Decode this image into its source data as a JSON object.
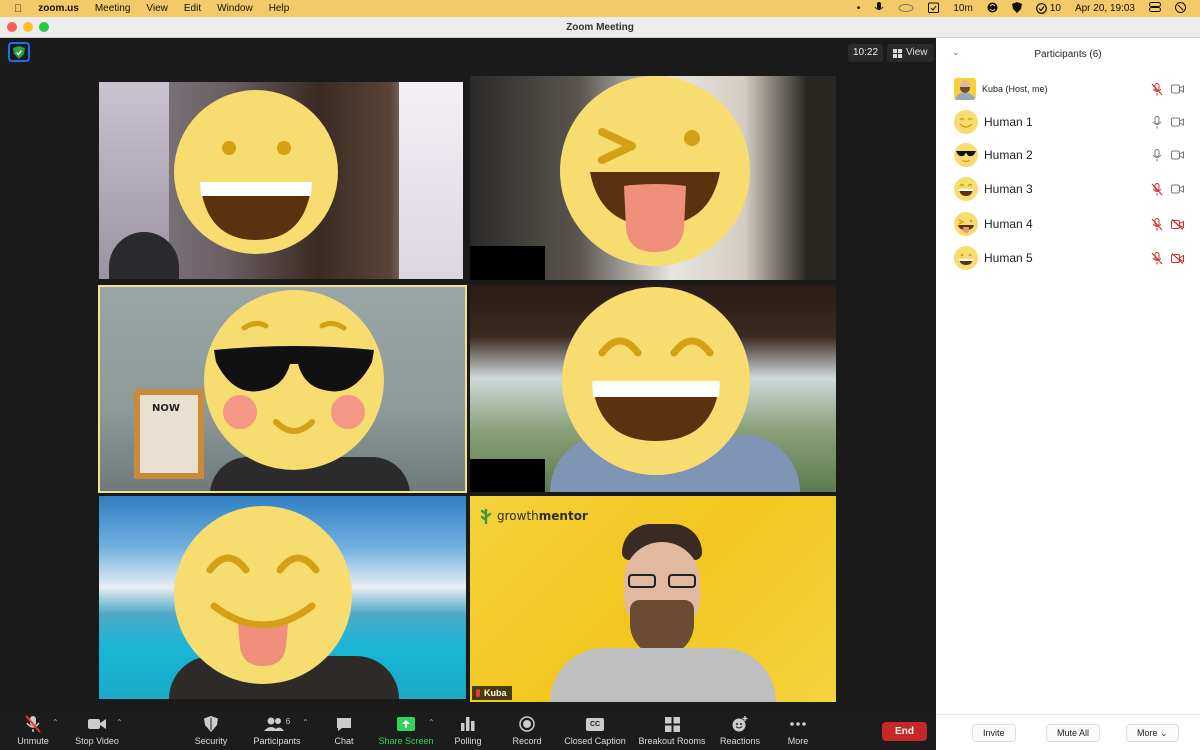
{
  "menubar": {
    "app_name": "zoom.us",
    "items": [
      "Meeting",
      "View",
      "Edit",
      "Window",
      "Help"
    ],
    "status": {
      "timer": "10m",
      "count": "10",
      "datetime": "Apr 20, 19:03"
    }
  },
  "window": {
    "title": "Zoom Meeting"
  },
  "stage": {
    "clock": "10:22",
    "view_label": "View"
  },
  "tiles": [
    {
      "id": "tile-1",
      "emoji": "grin"
    },
    {
      "id": "tile-2",
      "emoji": "wink-tongue"
    },
    {
      "id": "tile-3",
      "emoji": "sunglasses",
      "poster": "NOW"
    },
    {
      "id": "tile-4",
      "emoji": "laugh"
    },
    {
      "id": "tile-5",
      "emoji": "squint-tongue"
    },
    {
      "id": "tile-6",
      "brand": "growthmentor",
      "brand_part1": "growth",
      "brand_part2": "mentor",
      "name": "Kuba"
    }
  ],
  "toolbar": {
    "items": [
      {
        "label": "Unmute",
        "icon": "mic-off-icon"
      },
      {
        "label": "Stop Video",
        "icon": "video-icon"
      },
      {
        "label": "Security",
        "icon": "shield-icon"
      },
      {
        "label": "Participants",
        "icon": "participants-icon",
        "badge": "6"
      },
      {
        "label": "Chat",
        "icon": "chat-icon"
      },
      {
        "label": "Share Screen",
        "icon": "share-screen-icon"
      },
      {
        "label": "Polling",
        "icon": "polling-icon"
      },
      {
        "label": "Record",
        "icon": "record-icon"
      },
      {
        "label": "Closed Caption",
        "icon": "cc-icon",
        "icon_text": "CC"
      },
      {
        "label": "Breakout Rooms",
        "icon": "breakout-icon"
      },
      {
        "label": "Reactions",
        "icon": "reactions-icon"
      },
      {
        "label": "More",
        "icon": "more-icon"
      }
    ],
    "end_label": "End"
  },
  "participants_panel": {
    "title": "Participants (6)",
    "participants": [
      {
        "name": "Kuba (Host, me)",
        "avatar": "photo",
        "mic": "muted",
        "video": "on"
      },
      {
        "name": "Human 1",
        "avatar": "grin",
        "mic": "on",
        "video": "on"
      },
      {
        "name": "Human 2",
        "avatar": "sunglasses",
        "mic": "on",
        "video": "on"
      },
      {
        "name": "Human 3",
        "avatar": "laugh",
        "mic": "muted",
        "video": "on"
      },
      {
        "name": "Human 4",
        "avatar": "tongue",
        "mic": "muted",
        "video": "off"
      },
      {
        "name": "Human 5",
        "avatar": "grin",
        "mic": "muted",
        "video": "off"
      }
    ],
    "footer": {
      "invite": "Invite",
      "mute_all": "Mute All",
      "more": "More"
    }
  },
  "colors": {
    "menubar": "#f4c968",
    "emoji_yellow": "#f7dc6f",
    "active_speaker": "#f3e38a",
    "end": "#c62828",
    "share": "#2fd35a",
    "muted": "#d32f2f"
  }
}
